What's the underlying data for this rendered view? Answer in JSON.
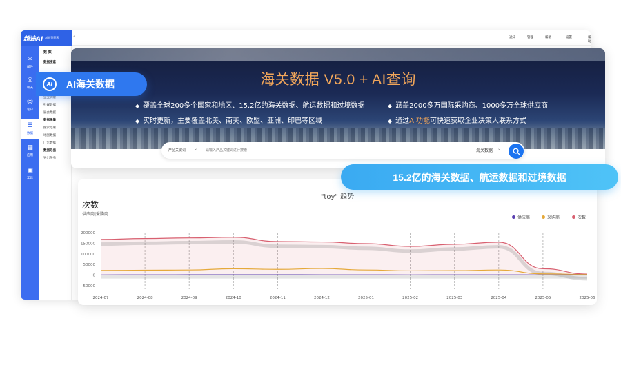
{
  "app": {
    "logo_text": "超途AI",
    "logo_sub": "AI外贸获客",
    "rail": [
      {
        "icon": "mail-icon",
        "label": "邮件",
        "glyph": "✉"
      },
      {
        "icon": "whatsapp-icon",
        "label": "聊天",
        "glyph": "◎"
      },
      {
        "icon": "customer-icon",
        "label": "客户",
        "glyph": "☺"
      },
      {
        "icon": "data-icon",
        "label": "数据",
        "glyph": "☰"
      },
      {
        "icon": "apps-icon",
        "label": "应用",
        "glyph": "▦"
      },
      {
        "icon": "tools-icon",
        "label": "工具",
        "glyph": "▣"
      }
    ],
    "subnav": {
      "head": "数 数",
      "items": [
        "数据搜索",
        "企业洞察",
        "社媒数据",
        "展会数据",
        "数据采集",
        "搜索结果",
        "地图数据",
        "广告数据",
        "数据导出",
        "导出任务"
      ]
    },
    "topbar": [
      "通知",
      "管理",
      "帮助",
      "设置",
      "帮助"
    ]
  },
  "hero": {
    "title": "海关数据 V5.0 + AI查询",
    "bullets": [
      "覆盖全球200多个国家和地区、15.2亿的海关数据、航运数据和过境数据",
      "实时更新，主要覆盖北美、南美、欧盟、亚洲、印巴等区域",
      "涵盖2000多万国际采购商、1000多万全球供应商"
    ],
    "bullet4_pre": "通过",
    "bullet4_hl": "AI功能",
    "bullet4_post": "可快速获取企业决策人联系方式",
    "search": {
      "type_label": "产品关键词",
      "placeholder": "请输入产品关键词进行搜索",
      "source_label": "海关数据"
    }
  },
  "pill_left": {
    "badge": "AI",
    "text": "AI海关数据"
  },
  "pill_right": {
    "text": "15.2亿的海关数据、航运数据和过境数据"
  },
  "chart_data": {
    "type": "line",
    "title": "\"toy\" 趋势",
    "ylabel": "次数",
    "ysub": "供应商|采购商",
    "categories": [
      "2024-07",
      "2024-08",
      "2024-09",
      "2024-10",
      "2024-11",
      "2024-12",
      "2025-01",
      "2025-02",
      "2025-03",
      "2025-04",
      "2025-05",
      "2025-06"
    ],
    "yticks": [
      "200000",
      "150000",
      "100000",
      "50000",
      "0",
      "-50000"
    ],
    "ylim": [
      -50000,
      200000
    ],
    "legend_position": "top-right",
    "series": [
      {
        "name": "供应商",
        "color": "#5a3fb0",
        "values": [
          1000,
          1200,
          1500,
          1800,
          1500,
          1400,
          1200,
          1000,
          1100,
          1300,
          1000,
          500
        ]
      },
      {
        "name": "采购商",
        "color": "#e5a93a",
        "values": [
          22000,
          23000,
          24000,
          30000,
          27000,
          31000,
          24000,
          20000,
          21000,
          24000,
          6000,
          3000
        ]
      },
      {
        "name": "次数",
        "color": "#d86070",
        "values": [
          168000,
          172000,
          175000,
          178000,
          158000,
          156000,
          148000,
          135000,
          145000,
          155000,
          30000,
          5000
        ]
      }
    ]
  }
}
